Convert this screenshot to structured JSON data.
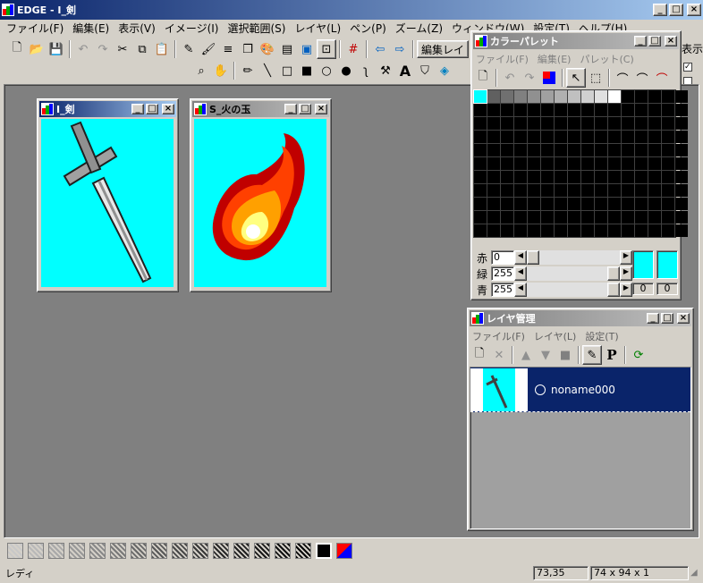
{
  "app": {
    "title": "EDGE - I_剣"
  },
  "menu": [
    "ファイル(F)",
    "編集(E)",
    "表示(V)",
    "イメージ(I)",
    "選択範囲(S)",
    "レイヤ(L)",
    "ペン(P)",
    "ズーム(Z)",
    "ウィンドウ(W)",
    "設定(T)",
    "ヘルプ(H)"
  ],
  "toolbar": {
    "edit_layer_label": "編集レイ",
    "view_label": "表示"
  },
  "doc1": {
    "title": "I_剣"
  },
  "doc2": {
    "title": "S_火の玉"
  },
  "palette": {
    "title": "カラーパレット",
    "menu": [
      "ファイル(F)",
      "編集(E)",
      "パレット(C)"
    ],
    "red_label": "赤",
    "green_label": "緑",
    "blue_label": "青",
    "red": "0",
    "green": "255",
    "blue": "255",
    "fg_index": "0",
    "bg_index": "0",
    "fg_color": "#00ffff",
    "swatches": [
      "#00ffff",
      "#606060",
      "#707070",
      "#808080",
      "#909090",
      "#a0a0a0",
      "#b0b0b0",
      "#c0c0c0",
      "#d0d0d0",
      "#e0e0e0",
      "#ffffff"
    ]
  },
  "layer": {
    "title": "レイヤ管理",
    "menu": [
      "ファイル(F)",
      "レイヤ(L)",
      "設定(T)"
    ],
    "item_name": "noname000",
    "p_label": "P"
  },
  "status": {
    "text": "レディ",
    "coords": "73,35",
    "size": "74 x 94 x 1"
  }
}
